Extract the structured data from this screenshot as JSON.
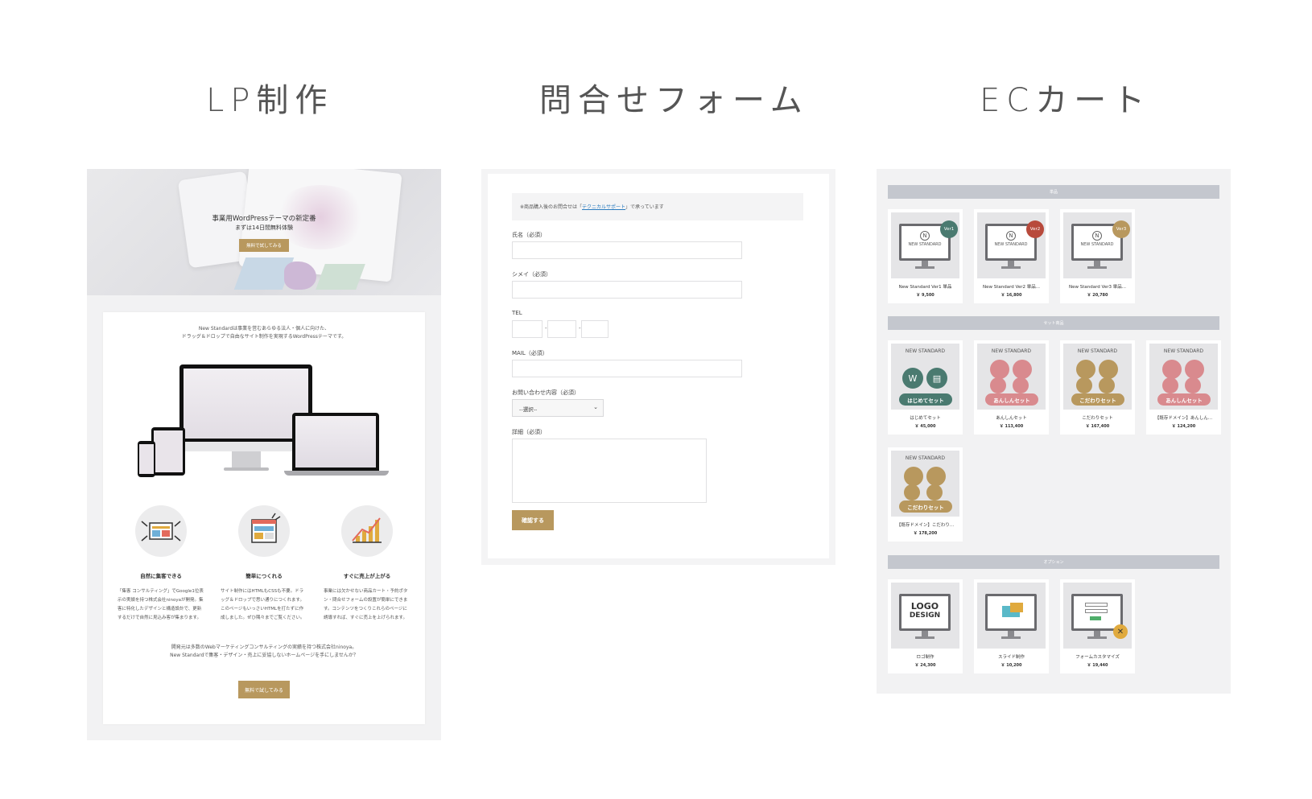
{
  "titles": {
    "lp": "LP制作",
    "form": "問合せフォーム",
    "ec": "ECカート"
  },
  "colors": {
    "accent": "#b8985e",
    "header_gray": "#c4c7ce",
    "teal": "#4a7a70",
    "red": "#b84a3c",
    "gold": "#b8985e",
    "pink": "#d98a8e"
  },
  "lp": {
    "hero_title": "事業用WordPressテーマの新定番",
    "hero_sub": "まずは14日間無料体験",
    "hero_btn": "無料で試してみる",
    "intro": "New Standardは事業を営むあらゆる法人・個人に向けた、\nドラッグ＆ドロップで自由なサイト制作を実現するWordPressテーマです。",
    "features": [
      {
        "icon": "target-screen-icon",
        "title": "自然に集客できる",
        "text": "「集客 コンサルティング」でGoogle1位表示の実績を持つ株式会社ninoyaが開発。集客に特化したデザインと構造設計で、更新するだけで自然に見込み客が集まります。"
      },
      {
        "icon": "browser-layout-icon",
        "title": "簡単につくれる",
        "text": "サイト制作にはHTMLもCSSも不要。ドラッグ＆ドロップで思い通りにつくれます。このページもいっさいHTMLを打たずに作成しました。ぜひ隅々までご覧ください。"
      },
      {
        "icon": "growth-chart-icon",
        "title": "すぐに売上が上がる",
        "text": "事業には欠かせない商品カート・予約ポタン・問合せフォームの設置が簡単にできます。コンテンツをつくりこれらのページに誘導すれば、すぐに売上を上げられます。"
      }
    ],
    "outro": "開発元は多数のWebマーケティングコンサルティングの実績を持つ株式会社ninoya。\nNew Standardで集客・デザイン・売上に妥協しないホームページを手にしませんか？",
    "cta_btn": "無料で試してみる"
  },
  "form": {
    "note_pre": "※商品購入後のお問合せは「",
    "note_link": "テクニカルサポート",
    "note_post": "」で承っています",
    "name_label": "氏名（必須）",
    "kana_label": "シメイ（必須）",
    "tel_label": "TEL",
    "tel_sep": "-",
    "mail_label": "MAIL（必須）",
    "inquiry_label": "お問い合わせ内容（必須）",
    "inquiry_value": "--選択--",
    "detail_label": "詳細（必須）",
    "submit": "確認する"
  },
  "ec": {
    "sections": [
      "単品",
      "セット商品",
      "オプション"
    ],
    "singles": [
      {
        "name": "New Standard Ver1 単品",
        "price": "￥ 9,500",
        "badge": "Ver1",
        "badge_color": "#4a7a70",
        "logo": "NEW STANDARD",
        "logo_mark": "N"
      },
      {
        "name": "New Standard Ver2 単品...",
        "price": "￥ 16,800",
        "badge": "Ver2",
        "badge_color": "#b84a3c",
        "logo": "NEW STANDARD",
        "logo_mark": "N"
      },
      {
        "name": "New Standard Ver3 単品...",
        "price": "￥ 20,780",
        "badge": "Ver3",
        "badge_color": "#b8985e",
        "logo": "NEW STANDARD",
        "logo_mark": "N"
      }
    ],
    "sets": [
      {
        "name": "はじめてセット",
        "price": "￥ 45,000",
        "pill": "はじめてセット",
        "color": "#4a7a70",
        "logo": "NEW STANDARD"
      },
      {
        "name": "あんしんセット",
        "price": "￥ 113,400",
        "pill": "あんしんセット",
        "color": "#d98a8e",
        "logo": "NEW STANDARD"
      },
      {
        "name": "こだわりセット",
        "price": "￥ 167,400",
        "pill": "こだわりセット",
        "color": "#b8985e",
        "logo": "NEW STANDARD"
      },
      {
        "name": "【既存ドメイン】あんしん...",
        "price": "￥ 124,200",
        "pill": "あんしんセット",
        "color": "#d98a8e",
        "logo": "NEW STANDARD"
      },
      {
        "name": "【既存ドメイン】こだわり...",
        "price": "￥ 178,200",
        "pill": "こだわりセット",
        "color": "#b8985e",
        "logo": "NEW STANDARD"
      }
    ],
    "options": [
      {
        "name": "ロゴ制作",
        "price": "￥ 24,300",
        "icon": "logo-design-icon",
        "screen_text_1": "LOGO",
        "screen_text_2": "DESIGN"
      },
      {
        "name": "スライド制作",
        "price": "￥ 10,200",
        "icon": "slide-icon"
      },
      {
        "name": "フォームカスタマイズ",
        "price": "￥ 19,440",
        "icon": "form-custom-icon"
      }
    ]
  }
}
